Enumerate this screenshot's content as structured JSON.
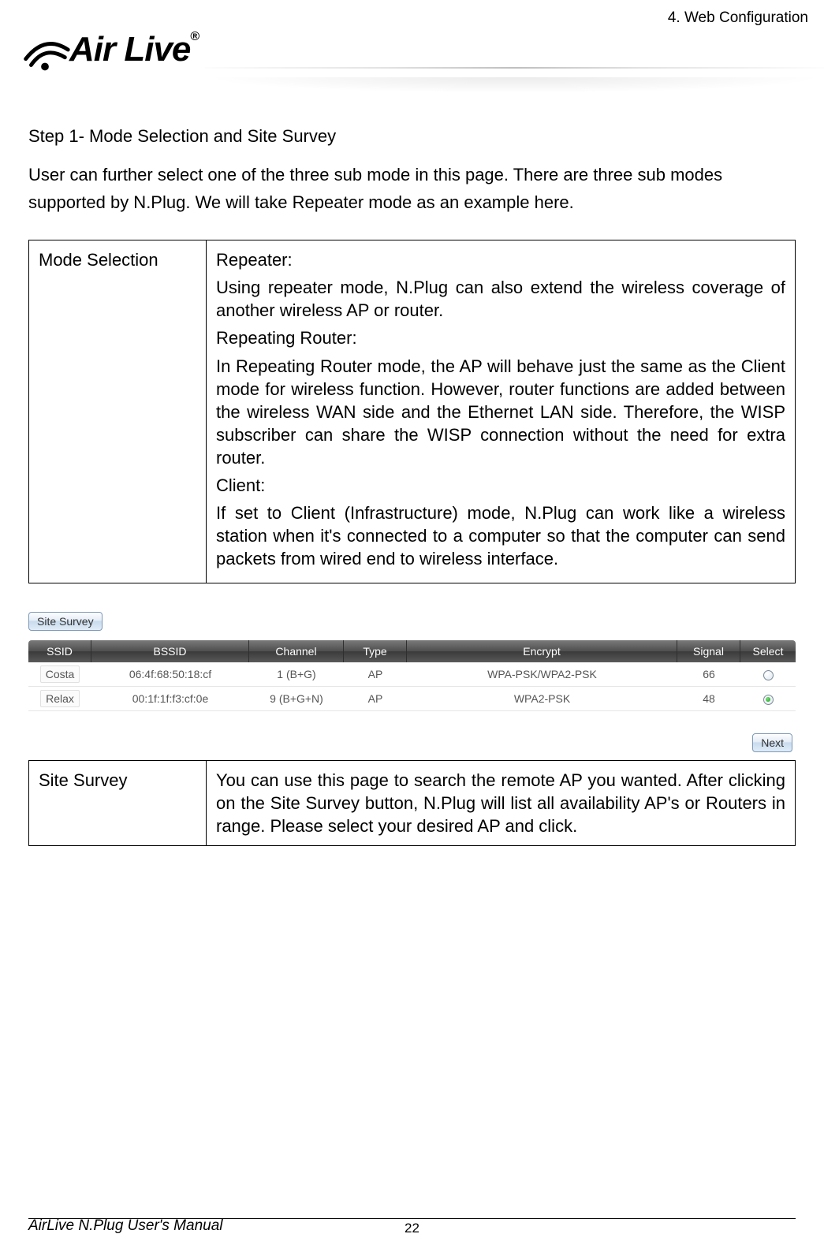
{
  "header": {
    "section_title": "4. Web Configuration",
    "logo_text": "Air Live",
    "logo_reg": "®"
  },
  "body": {
    "step_title": "Step 1- Mode Selection and Site Survey",
    "intro": "User can further select one of the three sub mode in this page. There are three sub modes supported by N.Plug. We will take Repeater mode as an example here.",
    "mode_table": {
      "label": "Mode Selection",
      "repeater_title": "Repeater:",
      "repeater_desc": "Using repeater mode, N.Plug can also extend the wireless coverage of another wireless AP or router.",
      "repeating_router_title": "Repeating Router:",
      "repeating_router_desc": "In Repeating Router mode, the AP will behave just the same as the Client mode for wireless function. However, router functions are added between the wireless WAN side and the Ethernet LAN side. Therefore, the WISP subscriber can share the WISP connection without the need for extra router.",
      "client_title": "Client:",
      "client_desc": "If set to Client (Infrastructure) mode, N.Plug can work like a wireless station when it's connected to a computer so that the computer can send packets from wired end to wireless interface."
    },
    "survey_ui": {
      "site_survey_btn": "Site Survey",
      "next_btn": "Next",
      "columns": {
        "ssid": "SSID",
        "bssid": "BSSID",
        "channel": "Channel",
        "type": "Type",
        "encrypt": "Encrypt",
        "signal": "Signal",
        "select": "Select"
      },
      "rows": [
        {
          "ssid": "Costa",
          "bssid": "06:4f:68:50:18:cf",
          "channel": "1 (B+G)",
          "type": "AP",
          "encrypt": "WPA-PSK/WPA2-PSK",
          "signal": "66",
          "selected": false
        },
        {
          "ssid": "Relax",
          "bssid": "00:1f:1f:f3:cf:0e",
          "channel": "9 (B+G+N)",
          "type": "AP",
          "encrypt": "WPA2-PSK",
          "signal": "48",
          "selected": true
        }
      ]
    },
    "site_survey_table": {
      "label": "Site Survey",
      "desc": "You can use this page to search the remote AP you wanted. After clicking on the Site Survey button, N.Plug will list all availability AP's or Routers in range. Please select your desired AP and click."
    }
  },
  "footer": {
    "manual": "AirLive N.Plug User's Manual",
    "page": "22"
  }
}
